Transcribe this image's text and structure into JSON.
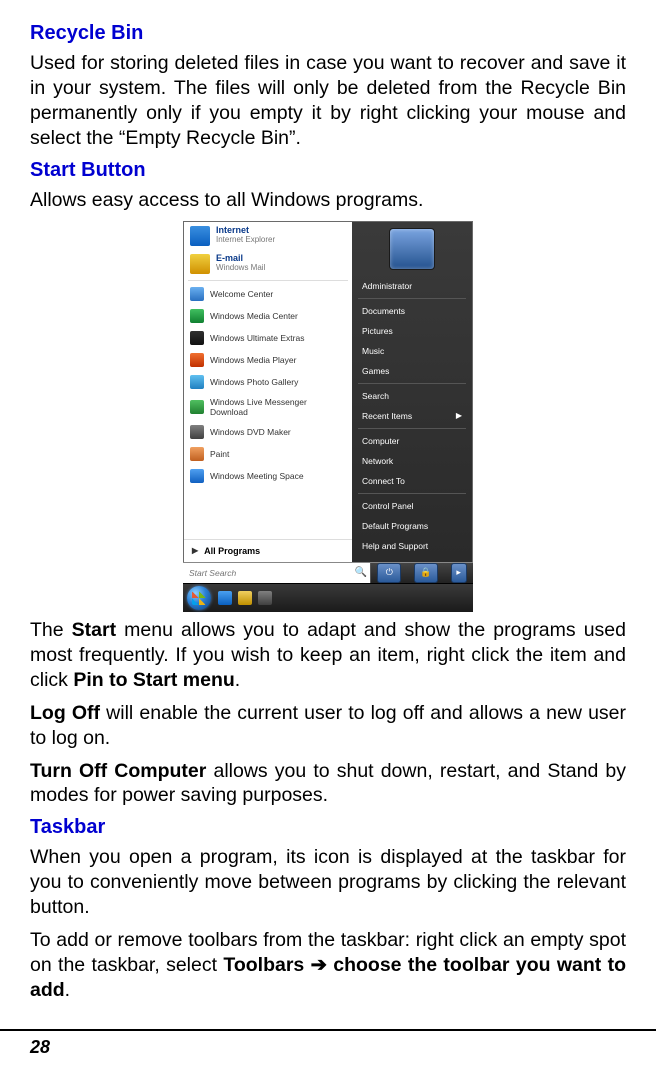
{
  "sections": {
    "recycle": {
      "heading": "Recycle Bin",
      "body": "Used for storing deleted files in case you want to recover and save it in your system. The files will only be deleted from the Recycle Bin permanently only if you empty it by right clicking your mouse and select the “Empty Recycle Bin”."
    },
    "start": {
      "heading": "Start Button",
      "intro": "Allows easy access to all Windows programs.",
      "p1_a": "The ",
      "p1_b": "Start",
      "p1_c": " menu allows you to adapt and show the programs used most frequently. If you wish to keep an item, right click the item and click ",
      "p1_d": "Pin to Start menu",
      "p1_e": ".",
      "p2_a": "Log Off",
      "p2_b": " will enable the current user to log off and allows a new user to log on.",
      "p3_a": "Turn Off Computer",
      "p3_b": " allows you to shut down, restart, and Stand by modes for power saving purposes."
    },
    "taskbar": {
      "heading": "Taskbar",
      "p1": "When you open a program, its icon is displayed at the taskbar for you to conveniently move between programs by clicking the relevant button.",
      "p2_a": "To add or remove toolbars from the taskbar: right click an empty spot on the taskbar, select ",
      "p2_b": "Toolbars ➔ choose the toolbar you want to add",
      "p2_c": "."
    }
  },
  "startmenu": {
    "pinned": [
      {
        "primary": "Internet",
        "secondary": "Internet Explorer",
        "icon_bg": "linear-gradient(#3a8fe0,#0a5fc0)"
      },
      {
        "primary": "E-mail",
        "secondary": "Windows Mail",
        "icon_bg": "linear-gradient(#f0d040,#d09000)"
      }
    ],
    "programs": [
      {
        "label": "Welcome Center",
        "icon_bg": "linear-gradient(#6ab0f0,#2a70c0)"
      },
      {
        "label": "Windows Media Center",
        "icon_bg": "linear-gradient(#40c060,#108030)"
      },
      {
        "label": "Windows Ultimate Extras",
        "icon_bg": "linear-gradient(#303030,#101010)"
      },
      {
        "label": "Windows Media Player",
        "icon_bg": "linear-gradient(#f07030,#c03000)"
      },
      {
        "label": "Windows Photo Gallery",
        "icon_bg": "linear-gradient(#60c0f0,#2080c0)"
      },
      {
        "label": "Windows Live Messenger Download",
        "icon_bg": "linear-gradient(#50c060,#208030)"
      },
      {
        "label": "Windows DVD Maker",
        "icon_bg": "linear-gradient(#808080,#404040)"
      },
      {
        "label": "Paint",
        "icon_bg": "linear-gradient(#f0a060,#c06020)"
      },
      {
        "label": "Windows Meeting Space",
        "icon_bg": "linear-gradient(#50a0f0,#1060c0)"
      }
    ],
    "all_programs": "All Programs",
    "search_placeholder": "Start Search",
    "right": [
      "Administrator",
      "Documents",
      "Pictures",
      "Music",
      "Games",
      "Search",
      "Recent Items",
      "Computer",
      "Network",
      "Connect To",
      "Control Panel",
      "Default Programs",
      "Help and Support"
    ],
    "right_arrow_index": 6
  },
  "page_number": "28"
}
